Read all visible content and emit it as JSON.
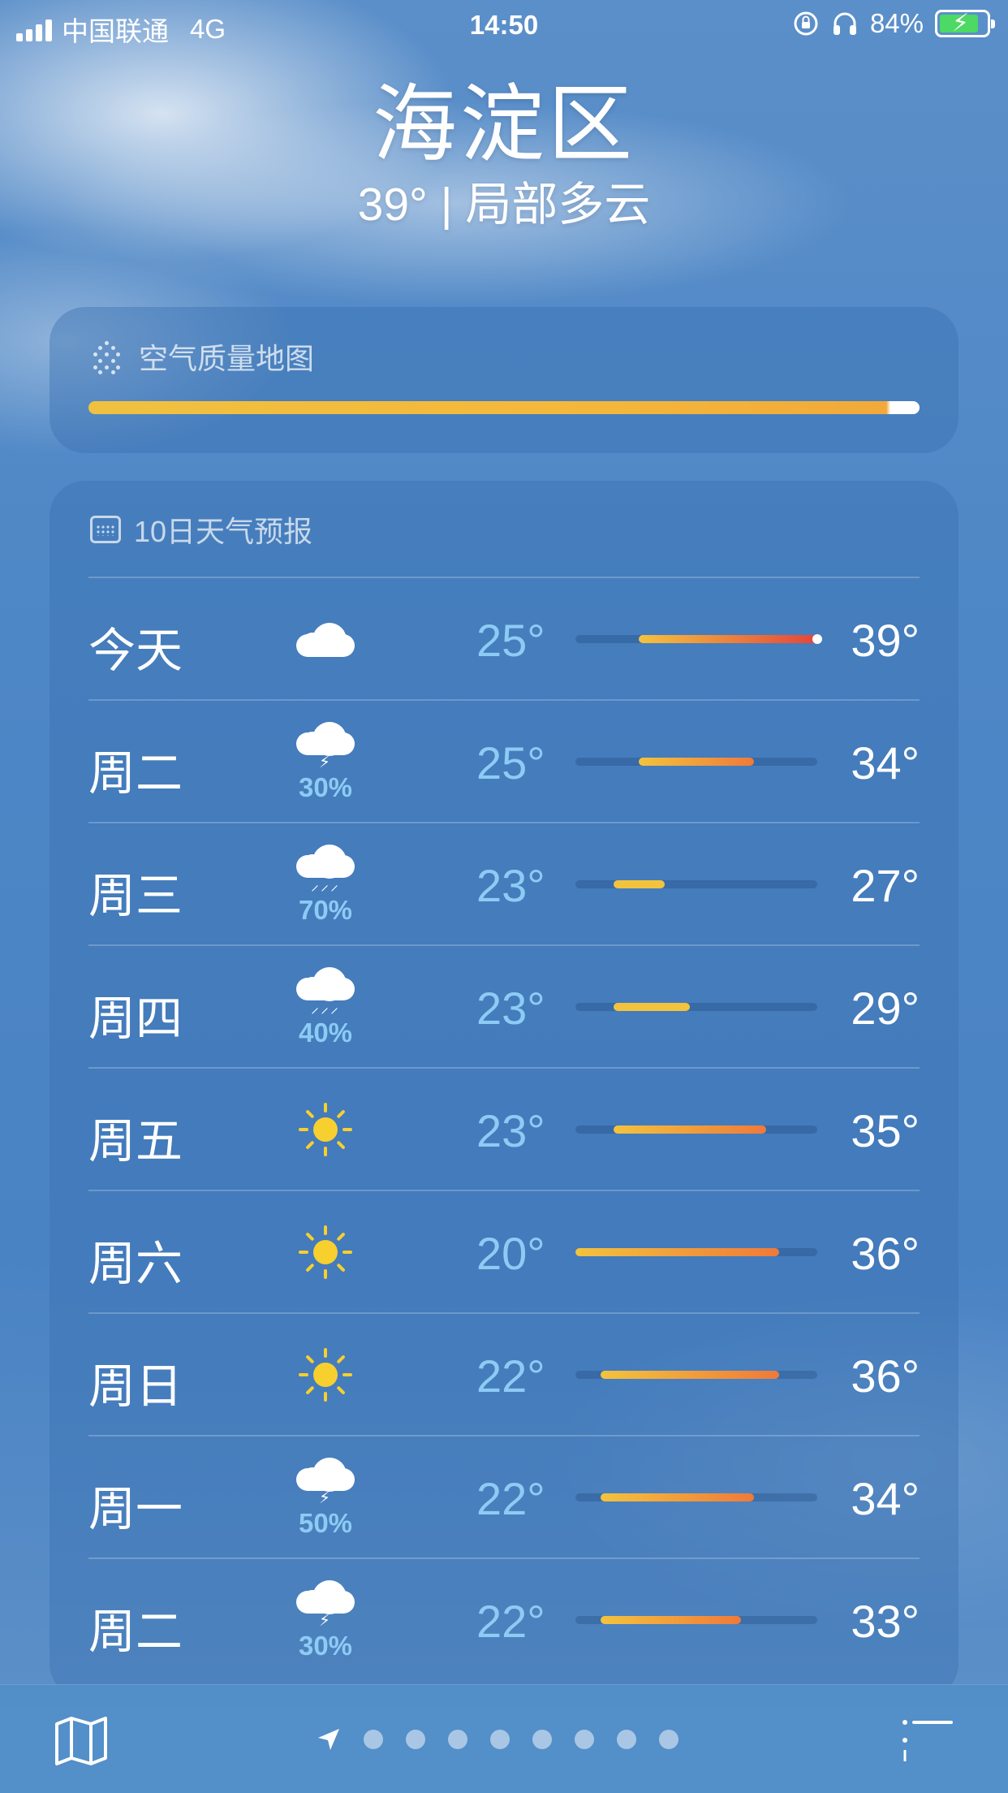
{
  "status_bar": {
    "carrier": "中国联通",
    "network": "4G",
    "time": "14:50",
    "battery": "84%",
    "battery_level": 0.84,
    "battery_color": "#4cd964"
  },
  "header": {
    "city": "海淀区",
    "summary": "39° | 局部多云"
  },
  "air_quality": {
    "title": "空气质量地图",
    "icon": "dot-grid-icon"
  },
  "forecast": {
    "title": "10日天气预报",
    "icon": "calendar-icon",
    "days": [
      {
        "day": "今天",
        "icon": "cloud-icon",
        "precip": "",
        "low": "25°",
        "high": "39°",
        "low_v": 25,
        "high_v": 39,
        "current_v": 39
      },
      {
        "day": "周二",
        "icon": "thunderstorm-icon",
        "precip": "30%",
        "low": "25°",
        "high": "34°",
        "low_v": 25,
        "high_v": 34
      },
      {
        "day": "周三",
        "icon": "rain-icon",
        "precip": "70%",
        "low": "23°",
        "high": "27°",
        "low_v": 23,
        "high_v": 27
      },
      {
        "day": "周四",
        "icon": "rain-icon",
        "precip": "40%",
        "low": "23°",
        "high": "29°",
        "low_v": 23,
        "high_v": 29
      },
      {
        "day": "周五",
        "icon": "sun-icon",
        "precip": "",
        "low": "23°",
        "high": "35°",
        "low_v": 23,
        "high_v": 35
      },
      {
        "day": "周六",
        "icon": "sun-icon",
        "precip": "",
        "low": "20°",
        "high": "36°",
        "low_v": 20,
        "high_v": 36
      },
      {
        "day": "周日",
        "icon": "sun-icon",
        "precip": "",
        "low": "22°",
        "high": "36°",
        "low_v": 22,
        "high_v": 36
      },
      {
        "day": "周一",
        "icon": "thunderstorm-icon",
        "precip": "50%",
        "low": "22°",
        "high": "34°",
        "low_v": 22,
        "high_v": 34
      },
      {
        "day": "周二",
        "icon": "thunderstorm-icon",
        "precip": "30%",
        "low": "22°",
        "high": "33°",
        "low_v": 22,
        "high_v": 33
      }
    ]
  },
  "bottom_bar": {
    "map_icon": "map-icon",
    "location_icon": "location-arrow-icon",
    "page_count": 8,
    "list_icon": "list-icon"
  },
  "colors": {
    "low_text": "#8ecbf4",
    "sun": "#f7cf2e",
    "aq_bar": "#f0c140",
    "bar_cool": "#f3c33e",
    "bar_warm": "#ef7a3a",
    "bar_hot": "#e5443a"
  }
}
